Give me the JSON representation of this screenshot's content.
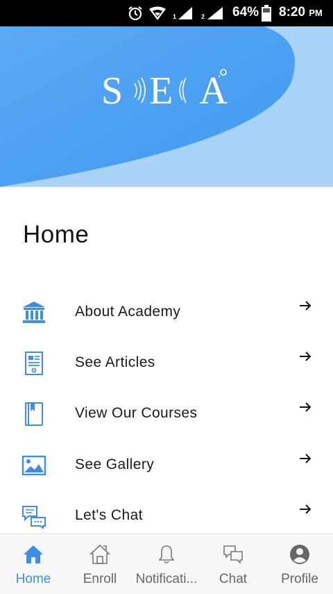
{
  "status_bar": {
    "battery_percent": "64%",
    "time": "8:20",
    "time_suffix": "PM",
    "sim1_label": "1",
    "sim2_label": "2"
  },
  "header": {
    "logo_text": "SEA",
    "colors": {
      "primary": "#4da3f5",
      "light": "#a9d4f7"
    }
  },
  "page": {
    "title": "Home"
  },
  "menu": {
    "items": [
      {
        "label": "About Academy",
        "icon": "academy-icon"
      },
      {
        "label": "See Articles",
        "icon": "articles-icon"
      },
      {
        "label": "View Our Courses",
        "icon": "courses-icon"
      },
      {
        "label": "See Gallery",
        "icon": "gallery-icon"
      },
      {
        "label": "Let's Chat",
        "icon": "chat-icon"
      }
    ]
  },
  "bottom_nav": {
    "tabs": [
      {
        "label": "Home",
        "icon": "home-icon",
        "active": true
      },
      {
        "label": "Enroll",
        "icon": "enroll-icon",
        "active": false
      },
      {
        "label": "Notificati...",
        "icon": "bell-icon",
        "active": false
      },
      {
        "label": "Chat",
        "icon": "chat-bubbles-icon",
        "active": false
      },
      {
        "label": "Profile",
        "icon": "profile-icon",
        "active": false
      }
    ],
    "active_color": "#3b8fe8",
    "inactive_color": "#666666"
  }
}
